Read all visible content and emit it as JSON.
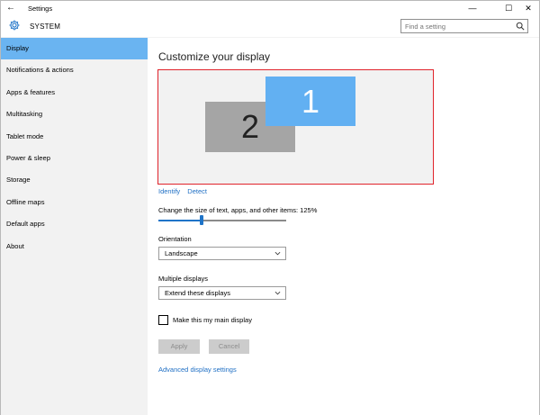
{
  "window": {
    "title": "Settings",
    "back_glyph": "←",
    "minimize_glyph": "—",
    "maximize_glyph": "☐",
    "close_glyph": "✕"
  },
  "header": {
    "section": "SYSTEM",
    "search_placeholder": "Find a setting",
    "icon": "gear-icon"
  },
  "sidebar": {
    "items": [
      {
        "label": "Display",
        "active": true
      },
      {
        "label": "Notifications & actions"
      },
      {
        "label": "Apps & features"
      },
      {
        "label": "Multitasking"
      },
      {
        "label": "Tablet mode"
      },
      {
        "label": "Power & sleep"
      },
      {
        "label": "Storage"
      },
      {
        "label": "Offline maps"
      },
      {
        "label": "Default apps"
      },
      {
        "label": "About"
      }
    ]
  },
  "main": {
    "title": "Customize your display",
    "monitors": {
      "primary": "1",
      "secondary": "2"
    },
    "identify_label": "Identify",
    "detect_label": "Detect",
    "scale_label": "Change the size of text, apps, and other items: 125%",
    "scale_slider_fraction": 0.34,
    "orientation_label": "Orientation",
    "orientation_value": "Landscape",
    "multiple_displays_label": "Multiple displays",
    "multiple_displays_value": "Extend these displays",
    "main_display_checkbox_label": "Make this my main display",
    "main_display_checked": false,
    "apply_label": "Apply",
    "cancel_label": "Cancel",
    "advanced_link": "Advanced display settings"
  },
  "colors": {
    "accent": "#1f74c8",
    "sidebar_active": "#6ab4f1",
    "monitor_primary": "#62b0f2",
    "monitor_secondary": "#a9a9a9",
    "highlight_border": "#e0232b"
  }
}
